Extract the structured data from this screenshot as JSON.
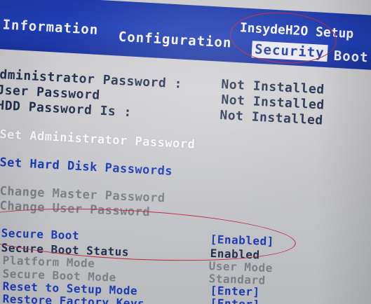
{
  "header": {
    "vendor": "InsydeH2O Setup",
    "tabs": [
      {
        "label": "Information"
      },
      {
        "label": "Configuration"
      },
      {
        "label": "Security"
      },
      {
        "label": "Boot"
      }
    ]
  },
  "passwords": {
    "admin_label": "Administrator Password :",
    "admin_label_visible": "dministrator Password :",
    "admin_value": "Not Installed",
    "user_label_visible": "Jser Password",
    "user_value": "Not Installed",
    "hdd_label_visible": "HDD Password Is :",
    "hdd_value": "Not Installed"
  },
  "actions": {
    "set_admin": "Set Administrator Password",
    "set_hdd": "Set Hard Disk Passwords",
    "change_master": "Change Master Password",
    "change_user": "Change User Password"
  },
  "secure_boot": {
    "secure_boot_label": "Secure Boot",
    "secure_boot_value": "[Enabled]",
    "status_label": "Secure Boot Status",
    "status_value": "Enabled",
    "platform_mode_label": "Platform Mode",
    "platform_mode_value": "User Mode",
    "boot_mode_label": "Secure Boot Mode",
    "boot_mode_value": "Standard",
    "reset_label": "Reset to Setup Mode",
    "reset_value": "[Enter]",
    "restore_label": "Restore Factory Keys",
    "restore_value": "[Enter]"
  },
  "colors": {
    "menubar": "#1f3bb0",
    "highlight_text": "#1c3bb3",
    "annotation": "#c0243a"
  }
}
